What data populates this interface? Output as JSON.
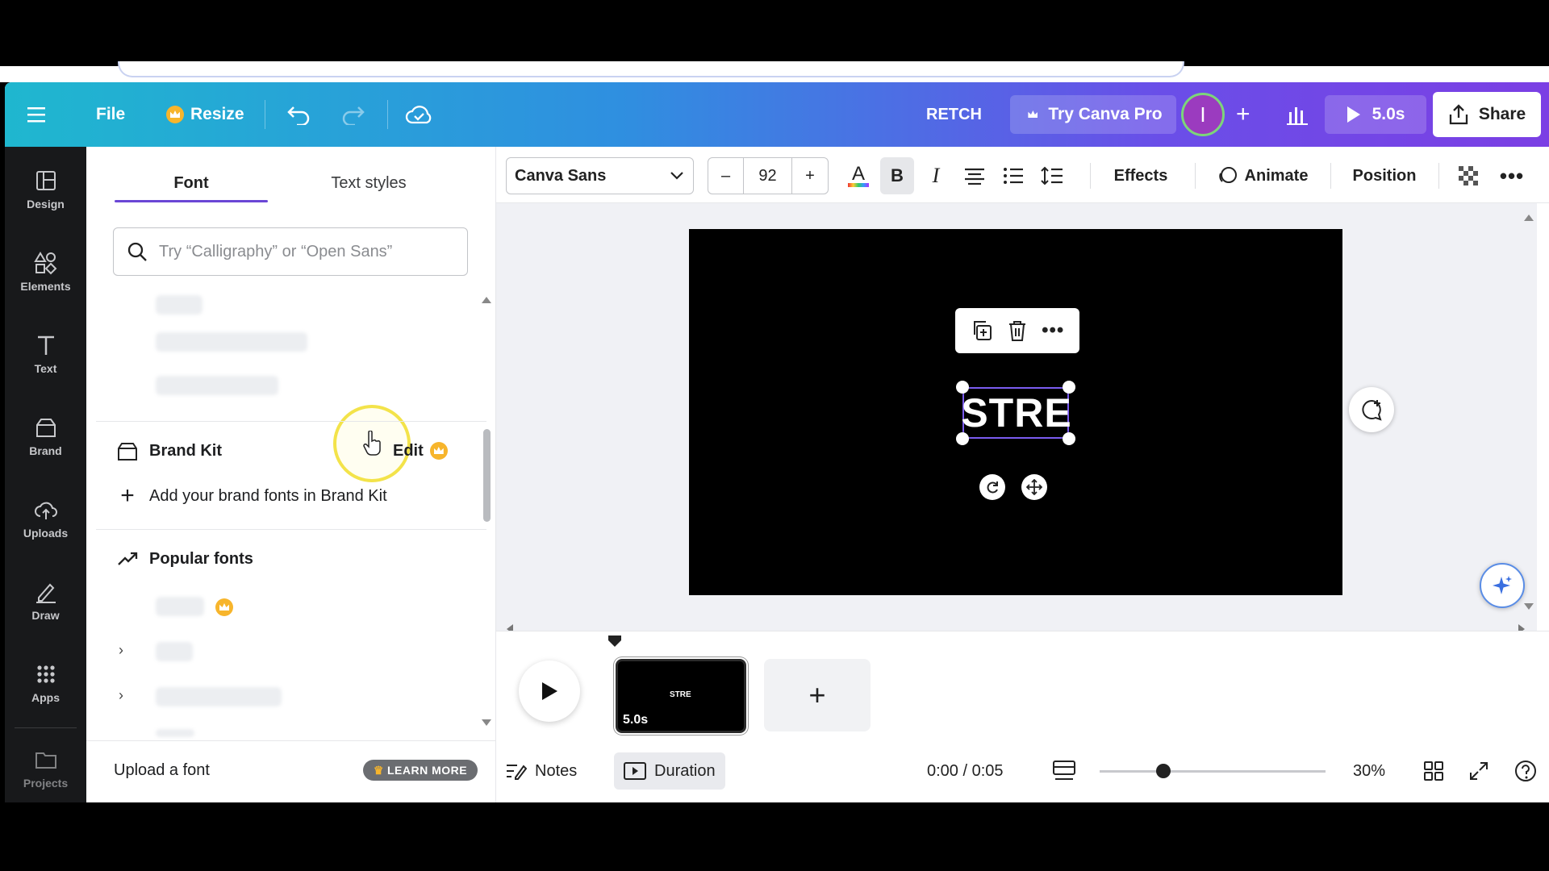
{
  "topbar": {
    "file_label": "File",
    "resize_label": "Resize",
    "design_title": "RETCH",
    "try_pro_label": "Try Canva Pro",
    "avatar_initial": "I",
    "play_label": "5.0s",
    "share_label": "Share"
  },
  "rail": {
    "items": [
      {
        "label": "Design",
        "icon": "design-icon"
      },
      {
        "label": "Elements",
        "icon": "elements-icon"
      },
      {
        "label": "Text",
        "icon": "text-icon"
      },
      {
        "label": "Brand",
        "icon": "brand-icon"
      },
      {
        "label": "Uploads",
        "icon": "uploads-icon"
      },
      {
        "label": "Draw",
        "icon": "draw-icon"
      },
      {
        "label": "Apps",
        "icon": "apps-icon"
      },
      {
        "label": "Projects",
        "icon": "folder-icon"
      }
    ]
  },
  "panel": {
    "tabs": [
      {
        "label": "Font",
        "active": true
      },
      {
        "label": "Text styles",
        "active": false
      }
    ],
    "search_placeholder": "Try “Calligraphy” or “Open Sans”",
    "brand_kit_label": "Brand Kit",
    "brand_kit_edit": "Edit",
    "brand_kit_add": "Add your brand fonts in Brand Kit",
    "popular_fonts_label": "Popular fonts",
    "upload_font_label": "Upload a font",
    "learn_more_label": "LEARN MORE"
  },
  "toolbar": {
    "font_name": "Canva Sans",
    "font_size": "92",
    "minus_label": "–",
    "plus_label": "+",
    "effects_label": "Effects",
    "animate_label": "Animate",
    "position_label": "Position"
  },
  "canvas": {
    "text_element": "STRE",
    "accent_color": "#7b5cf0"
  },
  "timeline": {
    "thumb_text": "STRE",
    "thumb_duration": "5.0s",
    "notes_label": "Notes",
    "duration_label": "Duration",
    "time_readout": "0:00 / 0:05",
    "zoom_level": "30%"
  }
}
